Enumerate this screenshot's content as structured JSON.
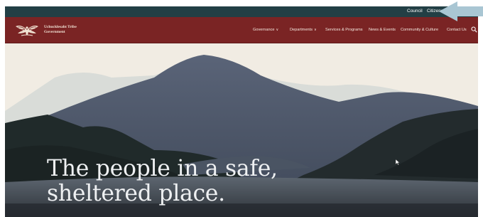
{
  "topbar": {
    "links": [
      "Council",
      "Citizens"
    ]
  },
  "brand": {
    "name_line1": "Uchucklesaht Tribe",
    "name_line2": "Government"
  },
  "nav": {
    "items": [
      {
        "label": "Governance",
        "has_dropdown": true
      },
      {
        "label": "Departments",
        "has_dropdown": true
      },
      {
        "label": "Services & Programs",
        "has_dropdown": false
      },
      {
        "label": "News & Events",
        "has_dropdown": false
      },
      {
        "label": "Community & Culture",
        "has_dropdown": false
      },
      {
        "label": "Contact Us",
        "has_dropdown": false
      }
    ],
    "search_icon": "search-icon"
  },
  "hero": {
    "headline_line1": "The people in a safe,",
    "headline_line2": "sheltered place."
  },
  "colors": {
    "topbar": "#223f45",
    "navbar": "#7a2424",
    "hero_background": "#f1ece3",
    "annotation_arrow": "#a9c6d3"
  }
}
